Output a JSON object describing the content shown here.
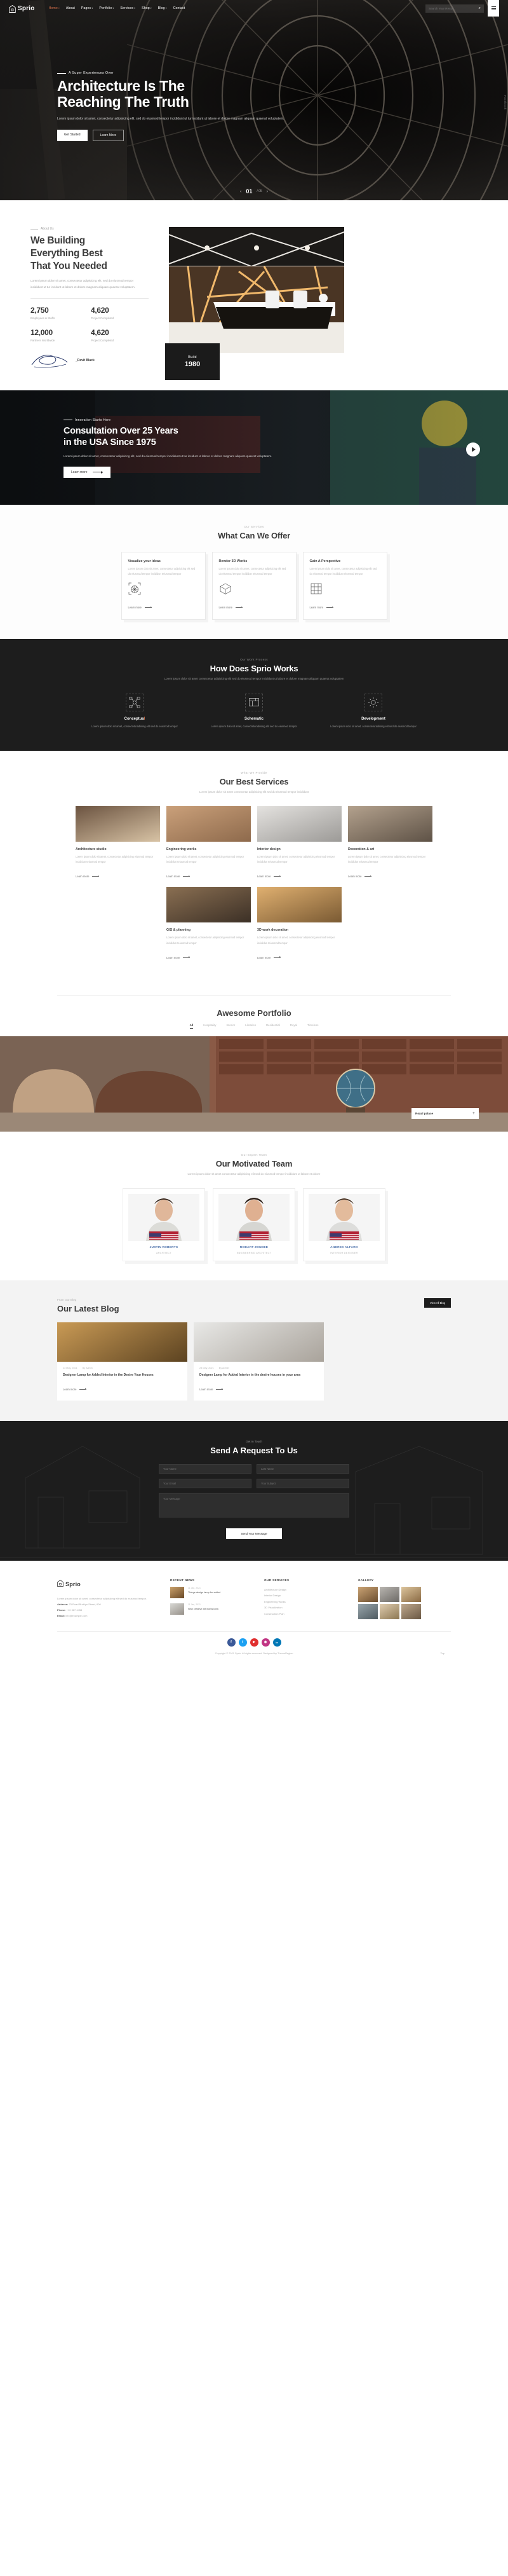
{
  "header": {
    "brand": "Sprio",
    "nav": [
      {
        "label": "Home",
        "caret": true,
        "active": true
      },
      {
        "label": "About",
        "caret": false,
        "active": false
      },
      {
        "label": "Pages",
        "caret": true,
        "active": false
      },
      {
        "label": "Portfolio",
        "caret": true,
        "active": false
      },
      {
        "label": "Services",
        "caret": true,
        "active": false
      },
      {
        "label": "Shop",
        "caret": true,
        "active": false
      },
      {
        "label": "Blog",
        "caret": true,
        "active": false
      },
      {
        "label": "Contact",
        "caret": false,
        "active": false
      }
    ],
    "search_placeholder": "Search Your Result.."
  },
  "hero": {
    "eyebrow": "A Super Experiences Over",
    "title_line1": "Architecture Is The",
    "title_line2": "Reaching The Truth",
    "paragraph": "Lorem ipsum dolor sit amet, consectetur adipisicing elit, sed do eiusmod tempor incididunt ut tur incidunt ut labore et dolore magnam aliquam quaerat voluptatem.",
    "btn_primary": "Get Started",
    "btn_secondary": "Learn More",
    "slide_current": "01",
    "slide_total": "/ 05",
    "side_social": "Facebook"
  },
  "about": {
    "eyebrow": "About Us",
    "title_line1": "We Building",
    "title_line2": "Everything Best",
    "title_line3": "That You Needed",
    "paragraph": "Lorem ipsum dolor sit amet, consectetur adipisicing elit, sed do eiusmod tempor incididunt ut tur incidunt ut labore et dolore magnam aliquam quaerat voluptatem.",
    "stats": [
      {
        "value": "2,750",
        "label": "Employees & Staffs"
      },
      {
        "value": "4,620",
        "label": "Project Completed"
      },
      {
        "value": "12,000",
        "label": "Partners Worldwide"
      },
      {
        "value": "4,620",
        "label": "Project Completed"
      }
    ],
    "signature_name": "Devit Black",
    "badge_title": "Build",
    "badge_year": "1980"
  },
  "consult": {
    "eyebrow": "Innovation Starts Here",
    "title_line1": "Consultation Over 25 Years",
    "title_line2": "in the USA Since 1975",
    "paragraph": "Lorem ipsum dolor sit amet, consectetur adipisicing elit, sed do eiusmod tempor incididunt ut tur incidunt ut labore et dolore magnam aliquam quaerat voluptatem.",
    "button": "Learn more"
  },
  "offer": {
    "kicker": "Our Services",
    "title": "What Can We Offer",
    "cards": [
      {
        "title": "Visualize your ideas",
        "text": "Lorem ipsum dolo sit amet, consectetur adipisicing elit sed do eiusmod tempor incididun teiusmod tempor",
        "link": "Learn more",
        "icon": "compass-icon"
      },
      {
        "title": "Render 3D Works",
        "text": "Lorem ipsum dolo sit amet, consectetur adipisicing elit sed do eiusmod tempor incididun teiusmod tempor",
        "link": "Learn more",
        "icon": "cube-icon"
      },
      {
        "title": "Gain A Perspective",
        "text": "Lorem ipsum dolo sit amet, consectetur adipisicing elit sed do eiusmod tempor incididun teiusmod tempor",
        "link": "Learn more",
        "icon": "grid-icon"
      }
    ]
  },
  "works": {
    "kicker": "Our Work Process",
    "title": "How Does Sprio Works",
    "subtitle": "Lorem ipsum dolor sit amet consectetur adipisicing elit sed do eiusmod tempor incididunt ut labore et dolore magnam aliquam quaerat voluptatem",
    "steps": [
      {
        "title_a": "Conceptua",
        "title_b": "l",
        "text": "Lorem ipsum dolo sit amet, consecteturadiising elit sed do eiusmod tempor",
        "icon": "idea-network-icon"
      },
      {
        "title_a": "Schematic",
        "title_b": "",
        "text": "Lorem ipsum dolo sit amet, consecteturadiising elit sed do eiusmod tempor",
        "icon": "blueprint-icon"
      },
      {
        "title_a": "Development",
        "title_b": "",
        "text": "Lorem ipsum dolo sit amet, consecteturadiising elit sed do eiusmod tempor",
        "icon": "gear-build-icon"
      }
    ]
  },
  "services": {
    "kicker": "What We Provide",
    "title": "Our Best Services",
    "subtitle": "Lorem ipsum dolor sit amet consectetur adipisicing elit sed do eiusmod tempor incididunt",
    "items": [
      {
        "title": "Architecture studio",
        "text": "Lorem ipsum dolo sit amet, consectetur adipisicing eiusmod tempor incididun teiusmod tempor",
        "link": "Learn more",
        "g1": "#6b5340",
        "g2": "#d8c3a5"
      },
      {
        "title": "Engineering works",
        "text": "Lorem ipsum dolo sit amet, consectetur adipisicing eiusmod tempor incididun teiusmod tempor",
        "link": "Learn more",
        "g1": "#caa07a",
        "g2": "#8e6a4c"
      },
      {
        "title": "Interior design",
        "text": "Lorem ipsum dolo sit amet, consectetur adipisicing eiusmod tempor incididun teiusmod tempor",
        "link": "Learn more",
        "g1": "#e4e2df",
        "g2": "#9c9a97"
      },
      {
        "title": "Decoration & art",
        "text": "Lorem ipsum dolo sit amet, consectetur adipisicing eiusmod tempor incididun teiusmod tempor",
        "link": "Learn more",
        "g1": "#b3a18d",
        "g2": "#5e5246"
      },
      {
        "title": "GIS & planning",
        "text": "Lorem ipsum dolo sit amet, consectetur adipisicing eiusmod tempor incididun teiusmod tempor",
        "link": "Learn more",
        "g1": "#8a6f52",
        "g2": "#3c3026"
      },
      {
        "title": "3D work decoration",
        "text": "Lorem ipsum dolo sit amet, consectetur adipisicing eiusmod tempor incididun teiusmod tempor",
        "link": "Learn more",
        "g1": "#e0b070",
        "g2": "#7a5a33"
      }
    ]
  },
  "portfolio": {
    "title": "Awesome Portfolio",
    "tabs": [
      "All",
      "Hospitality",
      "Interior",
      "Libraries",
      "Residential",
      "Royal",
      "Timeless"
    ],
    "active_tab": "All",
    "caption_title": "Royal palace",
    "caption_plus": "+"
  },
  "team": {
    "kicker": "Our Expert Team",
    "title": "Our Motivated Team",
    "subtitle": "Lorem ipsum dolor sit amet consectetur adipisicing elit sed do eiusmod tempor incididunt ut labore et dolore",
    "members": [
      {
        "name": "JUSTIN ROBERTS",
        "role": "ARCHITECT"
      },
      {
        "name": "ROBART ZONDEE",
        "role": "ENGINEERING ARCHITECT"
      },
      {
        "name": "ANDRES ALFARO",
        "role": "INTERIOR DESIGNER"
      }
    ]
  },
  "blog": {
    "kicker": "From Our Blog",
    "title": "Our Latest Blog",
    "view_all": "View All Blog",
    "posts": [
      {
        "date": "23 May, 2021",
        "author": "By Admin",
        "title": "Designer Lamp for Added Interior in the Desire Your Houses",
        "link": "Learn more",
        "g1": "#c99a55",
        "g2": "#5c4321"
      },
      {
        "date": "23 May, 2021",
        "author": "By Admin",
        "title": "Designer Lamp for Added Interior in the desire houses in your area",
        "link": "Learn more",
        "g1": "#e8e8e6",
        "g2": "#a9a39b"
      }
    ]
  },
  "contact": {
    "kicker": "Get In Touch",
    "title": "Send A Request To Us",
    "fields": {
      "name_placeholder": "Your Name",
      "lastname_placeholder": "Last Name",
      "email_placeholder": "Your Email",
      "subject_placeholder": "Your Subject",
      "message_placeholder": "Your Message"
    },
    "submit": "Send Your Message"
  },
  "footer": {
    "brand": "Sprio",
    "about_text": "Lorem ipsum dolor sit amet, consectetur adipisicing elit sed do eiusmod tempor.",
    "address_label": "Address:",
    "address": "75 Road Broklyn Street, 600",
    "phone_label": "Phone:",
    "phone": "+10 367 4458",
    "email_label": "Email:",
    "email": "info@example.com",
    "news_title": "RECENT NEWS",
    "news": [
      {
        "date": "11 Jan, 2021",
        "title": "Things design lamp for added"
      },
      {
        "date": "11 Jan, 2021",
        "title": "New creative art works idea"
      }
    ],
    "services_title": "OUR SERVICES",
    "services": [
      "Architecture Design",
      "Interior Design",
      "Engineering Works",
      "3D Visualization",
      "Construction Plan"
    ],
    "gallery_title": "GALLERY",
    "socials": [
      {
        "name": "facebook-icon",
        "glyph": "f",
        "color": "#3b5998"
      },
      {
        "name": "twitter-icon",
        "glyph": "t",
        "color": "#1da1f2"
      },
      {
        "name": "youtube-icon",
        "glyph": "▶",
        "color": "#e02f2f"
      },
      {
        "name": "instagram-icon",
        "glyph": "◉",
        "color": "#c13584"
      },
      {
        "name": "linkedin-icon",
        "glyph": "in",
        "color": "#0077b5"
      }
    ],
    "copyright": "Copyright © 2021 Sprio. All rights reserved. Designed by ThemeRegion",
    "scroll_top": "Top"
  }
}
